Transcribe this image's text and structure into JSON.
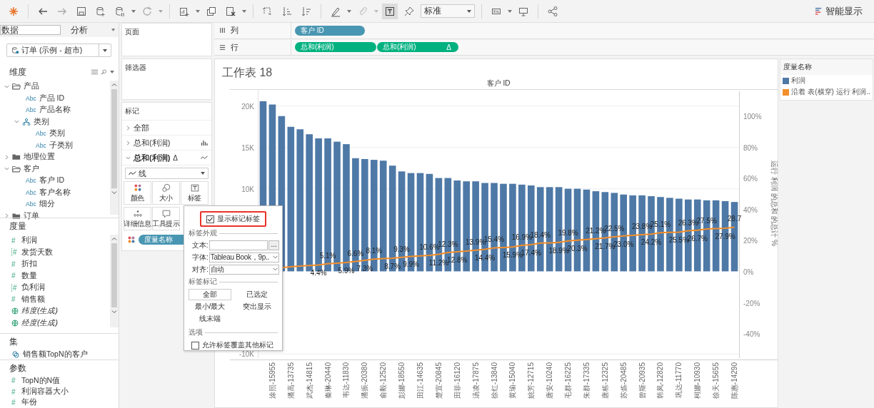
{
  "toolbar": {
    "view_select": "标准",
    "show_me": "智能显示"
  },
  "data_panel": {
    "tabs": [
      {
        "label": "数据",
        "selected": true
      },
      {
        "label": "分析",
        "selected": false
      }
    ],
    "datasource": "订单 (示例 - 超市)",
    "dimensions": {
      "title": "维度",
      "items": [
        {
          "kind": "folder",
          "label": "产品",
          "expanded": true,
          "children": [
            {
              "kind": "field",
              "tag": "Abc",
              "label": "产品 ID"
            },
            {
              "kind": "field",
              "tag": "Abc",
              "label": "产品名称"
            },
            {
              "kind": "hierarchy",
              "label": "类别",
              "expanded": true,
              "children": [
                {
                  "kind": "field",
                  "tag": "Abc",
                  "label": "类别"
                },
                {
                  "kind": "field",
                  "tag": "Abc",
                  "label": "子类别"
                }
              ]
            }
          ]
        },
        {
          "kind": "folder",
          "label": "地理位置",
          "expanded": false
        },
        {
          "kind": "folder",
          "label": "客户",
          "expanded": true,
          "children": [
            {
              "kind": "field",
              "tag": "Abc",
              "label": "客户 ID"
            },
            {
              "kind": "field",
              "tag": "Abc",
              "label": "客户名称"
            },
            {
              "kind": "field",
              "tag": "Abc",
              "label": "细分"
            }
          ]
        },
        {
          "kind": "folder",
          "label": "订单",
          "expanded": false
        }
      ]
    },
    "measures": {
      "title": "度量",
      "items": [
        {
          "kind": "number",
          "tag": "#",
          "label": "利润"
        },
        {
          "kind": "bin",
          "tag": "#",
          "label": "发货天数"
        },
        {
          "kind": "number",
          "tag": "#",
          "label": "折扣"
        },
        {
          "kind": "number",
          "tag": "#",
          "label": "数量"
        },
        {
          "kind": "bin",
          "tag": "#",
          "label": "负利润"
        },
        {
          "kind": "number",
          "tag": "#",
          "label": "销售额"
        },
        {
          "kind": "geo",
          "label": "纬度(生成)"
        },
        {
          "kind": "geo",
          "label": "经度(生成)"
        }
      ]
    },
    "sets": {
      "title": "集",
      "items": [
        {
          "label": "销售额TopN的客户"
        }
      ]
    },
    "parameters": {
      "title": "参数",
      "items": [
        {
          "tag": "#",
          "label": "TopN的N值"
        },
        {
          "tag": "#",
          "label": "利润容器大小"
        },
        {
          "tag": "#",
          "label": "年份"
        }
      ]
    }
  },
  "cards": {
    "pages": "页面",
    "filters": "筛选器",
    "marks": {
      "title": "标记",
      "layers": [
        {
          "kind": "all",
          "label": "全部",
          "expanded": false
        },
        {
          "kind": "bar",
          "label": "总和(利润)",
          "expanded": false
        },
        {
          "kind": "line",
          "label": "总和(利润)",
          "delta": "Δ",
          "expanded": true
        }
      ],
      "mark_type": "线",
      "buttons": [
        {
          "kind": "color",
          "label": "颜色"
        },
        {
          "kind": "size",
          "label": "大小"
        },
        {
          "kind": "label",
          "label": "标签"
        },
        {
          "kind": "detail",
          "label": "详细信息"
        },
        {
          "kind": "tooltip",
          "label": "工具提示"
        }
      ],
      "fields": [
        {
          "kind": "color",
          "label": "度量名称"
        }
      ]
    }
  },
  "shelves": [
    {
      "kind": "columns",
      "label": "列",
      "pills": [
        {
          "kind": "dimension",
          "label": "客户 ID"
        }
      ]
    },
    {
      "kind": "rows",
      "label": "行",
      "pills": [
        {
          "kind": "measure",
          "label": "总和(利润)"
        },
        {
          "kind": "measure",
          "label": "总和(利润)",
          "delta": "Δ"
        }
      ]
    }
  ],
  "sheet": {
    "title": "工作表 18",
    "header": "客户 ID",
    "bars": {
      "chart_data": {
        "type": "bar",
        "grid": true,
        "categories": [
          null,
          "涂照-15955",
          null,
          "潘高-13735",
          null,
          "武杰-14815",
          null,
          "秦琳-20440",
          null,
          "韦达-11830",
          null,
          "潘振-20380",
          null,
          "俞毅-12520",
          null,
          "彭娜-18550",
          null,
          "田江-14635",
          null,
          "楚宜-20845",
          null,
          "田菲-16120",
          null,
          "汤凌-17875",
          null,
          "徐红-13840",
          null,
          "黄瑜-15040",
          null,
          "姚芳-12715",
          null,
          "唐安-10240",
          null,
          "毛群-16225",
          null,
          "朱群-17335",
          null,
          "唐栋-12325",
          null,
          "苏炼-20485",
          null,
          "曾斯-20935",
          null,
          "韩凤-12820",
          null,
          "巩达-11770",
          null,
          "柯娜-10930",
          null,
          "徐天-15655",
          null,
          "陈惠-14290"
        ],
        "ylim": [
          -10500,
          21800
        ],
        "yticks": [
          {
            "value": 20000,
            "label": "20K"
          },
          {
            "value": 15000,
            "label": "15K"
          },
          {
            "value": 10000,
            "label": "10K"
          },
          {
            "value": -10000,
            "label": "-10K"
          }
        ],
        "series": [
          {
            "name": "利润",
            "color": "#4e79a7",
            "values": [
              20600,
              20200,
              18800,
              17500,
              17200,
              16600,
              16100,
              16100,
              15700,
              15400,
              13700,
              13600,
              13500,
              13400,
              12800,
              12100,
              11900,
              11900,
              11800,
              11300,
              11300,
              11000,
              10900,
              10900,
              10700,
              10700,
              10600,
              10600,
              10500,
              10400,
              10200,
              10200,
              10200,
              10000,
              10000,
              9900,
              9700,
              9600,
              9500,
              9300,
              9200,
              9200,
              9100,
              9000,
              8900,
              8800,
              8700,
              8700,
              8600,
              8600,
              8500,
              8400
            ]
          }
        ]
      }
    },
    "running_total": {
      "chart_data": {
        "type": "line",
        "ylabel": "运行 利润 的总和 的总计 %",
        "ylim": [
          -55.5,
          116
        ],
        "yticks": [
          {
            "value": 100,
            "label": "100%"
          },
          {
            "value": 80,
            "label": "80%"
          },
          {
            "value": 60,
            "label": "60%"
          },
          {
            "value": 40,
            "label": "40%"
          },
          {
            "value": 20,
            "label": "20%"
          },
          {
            "value": 0,
            "label": "0%"
          },
          {
            "value": -20,
            "label": "-20%"
          },
          {
            "value": -40,
            "label": "-40%"
          }
        ],
        "series": [
          {
            "name": "沿着 表(横穿) 运行 利润..",
            "color": "#f28e2b",
            "values": [
              null,
              null,
              2.6,
              3.2,
              3.6,
              4.0,
              4.4,
              5.1,
              5.5,
              5.9,
              6.6,
              7.3,
              8.1,
              8.4,
              8.7,
              9.3,
              9.9,
              10.2,
              10.6,
              11.2,
              12.3,
              12.8,
              13.3,
              13.9,
              14.4,
              15.4,
              15.6,
              15.9,
              16.9,
              17.4,
              18.4,
              18.6,
              18.9,
              19.8,
              20.3,
              20.7,
              21.2,
              21.7,
              22.5,
              23.0,
              23.4,
              23.8,
              24.2,
              25.1,
              25.3,
              25.5,
              26.3,
              26.7,
              27.5,
              27.7,
              27.9,
              28.7
            ]
          }
        ],
        "value_labels": [
          null,
          null,
          null,
          null,
          null,
          null,
          "4.4%",
          "5.1%",
          null,
          "5.9%",
          "6.6%",
          "7.3%",
          "8.1%",
          null,
          "8.7%",
          "9.3%",
          "9.9%",
          null,
          "10.6%",
          "11.2%",
          "12.3%",
          "12.8%",
          null,
          "13.9%",
          "14.4%",
          "15.4%",
          null,
          "15.9%",
          "16.9%",
          "17.4%",
          "18.4%",
          null,
          "18.9%",
          "19.8%",
          "20.3%",
          null,
          "21.2%",
          "21.7%",
          "22.5%",
          "23.0%",
          null,
          "23.8%",
          "24.2%",
          "25.1%",
          null,
          "25.5%",
          "26.3%",
          "26.7%",
          "27.5%",
          null,
          "27.9%",
          "28.7"
        ]
      }
    }
  },
  "legend": {
    "title": "度量名称"
  },
  "label_popup": {
    "show_labels": {
      "label": "显示标记标签",
      "checked": true,
      "highlighted": true
    },
    "appearance_title": "标签外观",
    "text_label": "文本:",
    "more": "...",
    "font_label": "字体:",
    "font_value": "Tableau Book，9p..",
    "align_label": "对齐:",
    "align_value": "自动",
    "marks_title": "标签标记",
    "mark_options": [
      {
        "label": "全部",
        "selected": true
      },
      {
        "label": "已选定",
        "selected": false
      },
      {
        "label": "最小/最大",
        "selected": false
      },
      {
        "label": "突出显示",
        "selected": false
      },
      {
        "label": "线末端",
        "selected": false
      }
    ],
    "options_title": "选项",
    "overlap": {
      "label": "允许标签覆盖其他标记",
      "checked": false
    }
  }
}
